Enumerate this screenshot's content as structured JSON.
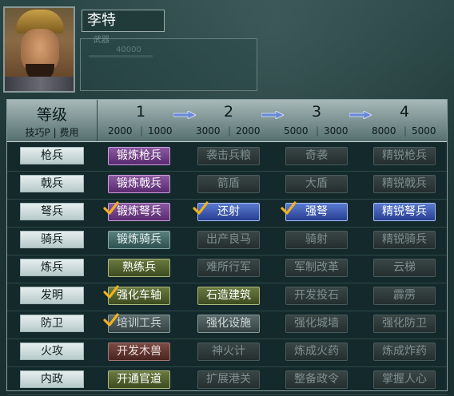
{
  "character": {
    "name": "李特"
  },
  "stats_panel": {
    "label": "武器",
    "value": "40000"
  },
  "table": {
    "level_label": "等级",
    "sub_label": "技巧P | 费用",
    "tiers": [
      {
        "num": "1",
        "tech": "2000",
        "cost": "1000"
      },
      {
        "num": "2",
        "tech": "3000",
        "cost": "2000"
      },
      {
        "num": "3",
        "tech": "5000",
        "cost": "3000"
      },
      {
        "num": "4",
        "tech": "8000",
        "cost": "5000"
      }
    ],
    "rows": [
      {
        "category": "枪兵",
        "skills": [
          {
            "label": "锻炼枪兵",
            "style": "purple",
            "checked": false
          },
          {
            "label": "袭击兵粮",
            "style": "dim",
            "checked": false
          },
          {
            "label": "奇袭",
            "style": "dim",
            "checked": false
          },
          {
            "label": "精锐枪兵",
            "style": "dim",
            "checked": false
          }
        ]
      },
      {
        "category": "戟兵",
        "skills": [
          {
            "label": "锻炼戟兵",
            "style": "purple",
            "checked": false
          },
          {
            "label": "箭盾",
            "style": "dim",
            "checked": false
          },
          {
            "label": "大盾",
            "style": "dim",
            "checked": false
          },
          {
            "label": "精锐戟兵",
            "style": "dim",
            "checked": false
          }
        ]
      },
      {
        "category": "弩兵",
        "skills": [
          {
            "label": "锻炼弩兵",
            "style": "purple",
            "checked": true
          },
          {
            "label": "还射",
            "style": "blue",
            "checked": true
          },
          {
            "label": "强弩",
            "style": "blue",
            "checked": true
          },
          {
            "label": "精锐弩兵",
            "style": "blue",
            "checked": false
          }
        ]
      },
      {
        "category": "骑兵",
        "skills": [
          {
            "label": "锻炼骑兵",
            "style": "teal",
            "checked": false
          },
          {
            "label": "出产良马",
            "style": "dim",
            "checked": false
          },
          {
            "label": "骑射",
            "style": "dim",
            "checked": false
          },
          {
            "label": "精锐骑兵",
            "style": "dim",
            "checked": false
          }
        ]
      },
      {
        "category": "炼兵",
        "skills": [
          {
            "label": "熟练兵",
            "style": "olive",
            "checked": false
          },
          {
            "label": "难所行军",
            "style": "dim",
            "checked": false
          },
          {
            "label": "军制改革",
            "style": "dim",
            "checked": false
          },
          {
            "label": "云梯",
            "style": "dim",
            "checked": false
          }
        ]
      },
      {
        "category": "发明",
        "skills": [
          {
            "label": "强化车轴",
            "style": "olive",
            "checked": true
          },
          {
            "label": "石造建筑",
            "style": "olive",
            "checked": false
          },
          {
            "label": "开发投石",
            "style": "dim",
            "checked": false
          },
          {
            "label": "霹雳",
            "style": "dim",
            "checked": false
          }
        ]
      },
      {
        "category": "防卫",
        "skills": [
          {
            "label": "培训工兵",
            "style": "gray",
            "checked": true
          },
          {
            "label": "强化设施",
            "style": "gray",
            "checked": false
          },
          {
            "label": "强化城墙",
            "style": "dim",
            "checked": false
          },
          {
            "label": "强化防卫",
            "style": "dim",
            "checked": false
          }
        ]
      },
      {
        "category": "火攻",
        "skills": [
          {
            "label": "开发木兽",
            "style": "red",
            "checked": false
          },
          {
            "label": "神火计",
            "style": "dim",
            "checked": false
          },
          {
            "label": "炼成火药",
            "style": "dim",
            "checked": false
          },
          {
            "label": "炼成炸药",
            "style": "dim",
            "checked": false
          }
        ]
      },
      {
        "category": "内政",
        "skills": [
          {
            "label": "开通官道",
            "style": "olive",
            "checked": false
          },
          {
            "label": "扩展港关",
            "style": "dim",
            "checked": false
          },
          {
            "label": "整备政令",
            "style": "dim",
            "checked": false
          },
          {
            "label": "掌握人心",
            "style": "dim",
            "checked": false
          }
        ]
      }
    ]
  },
  "colors": {
    "check": "#f0b020",
    "arrow": "#6a8ad8"
  }
}
